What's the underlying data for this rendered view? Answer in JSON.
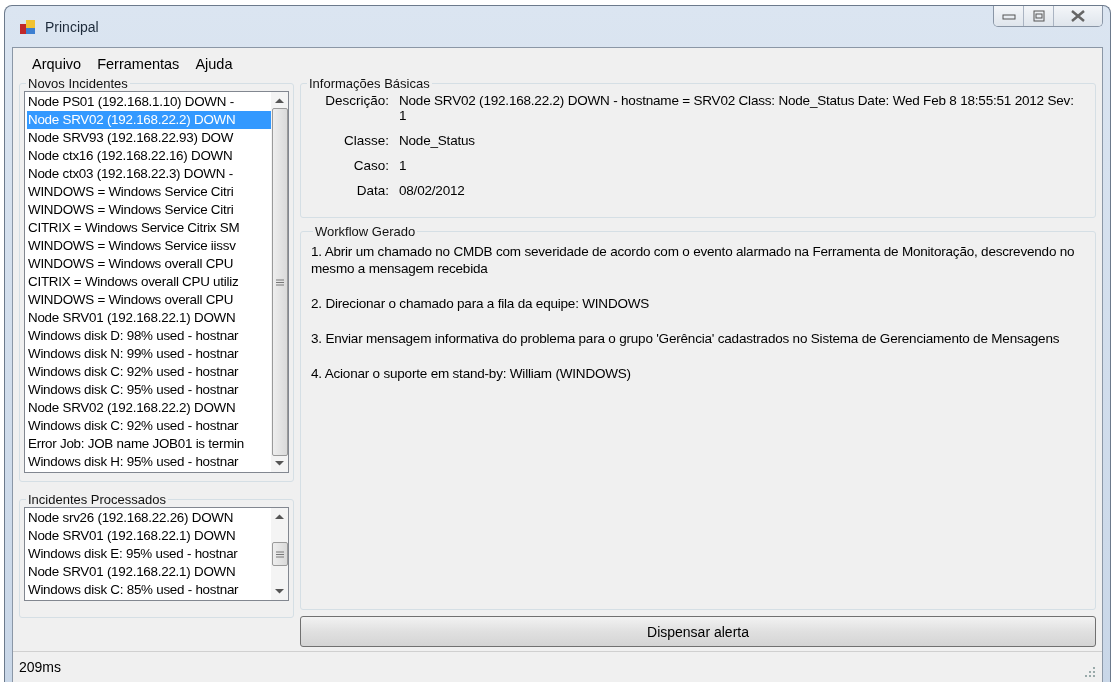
{
  "window": {
    "title": "Principal"
  },
  "menu": [
    "Arquivo",
    "Ferramentas",
    "Ajuda"
  ],
  "new_incidents": {
    "title": "Novos Incidentes",
    "items": [
      {
        "text": "Node PS01 (192.168.1.10) DOWN -",
        "selected": false
      },
      {
        "text": "Node SRV02 (192.168.22.2) DOWN",
        "selected": true
      },
      {
        "text": "Node SRV93 (192.168.22.93) DOW",
        "selected": false
      },
      {
        "text": "Node ctx16 (192.168.22.16) DOWN",
        "selected": false
      },
      {
        "text": "Node ctx03 (192.168.22.3) DOWN -",
        "selected": false
      },
      {
        "text": "WINDOWS = Windows Service Citri",
        "selected": false
      },
      {
        "text": "WINDOWS = Windows Service Citri",
        "selected": false
      },
      {
        "text": "CITRIX = Windows Service Citrix SM",
        "selected": false
      },
      {
        "text": "WINDOWS = Windows Service iissv",
        "selected": false
      },
      {
        "text": "WINDOWS = Windows overall CPU",
        "selected": false
      },
      {
        "text": "CITRIX = Windows overall CPU utiliz",
        "selected": false
      },
      {
        "text": "WINDOWS = Windows overall CPU",
        "selected": false
      },
      {
        "text": "Node SRV01 (192.168.22.1) DOWN",
        "selected": false
      },
      {
        "text": "Windows disk D: 98% used - hostnar",
        "selected": false
      },
      {
        "text": "Windows disk N: 99% used - hostnar",
        "selected": false
      },
      {
        "text": "Windows disk C: 92% used - hostnar",
        "selected": false
      },
      {
        "text": "Windows disk C: 95% used - hostnar",
        "selected": false
      },
      {
        "text": "Node SRV02 (192.168.22.2) DOWN",
        "selected": false
      },
      {
        "text": "Windows disk C: 92% used - hostnar",
        "selected": false
      },
      {
        "text": "Error Job: JOB name JOB01 is termin",
        "selected": false
      },
      {
        "text": "Windows disk H: 95% used - hostnar",
        "selected": false
      }
    ]
  },
  "processed_incidents": {
    "title": "Incidentes Processados",
    "items": [
      {
        "text": "Node srv26 (192.168.22.26) DOWN",
        "selected": false
      },
      {
        "text": "Node SRV01 (192.168.22.1) DOWN",
        "selected": false
      },
      {
        "text": "Windows disk E: 95% used - hostnar",
        "selected": false
      },
      {
        "text": "Node SRV01 (192.168.22.1) DOWN",
        "selected": false
      },
      {
        "text": "Windows disk C: 85% used - hostnar",
        "selected": false
      }
    ]
  },
  "basic_info": {
    "title": "Informações Básicas",
    "fields": [
      {
        "label": "Descrição:",
        "value": "Node SRV02 (192.168.22.2) DOWN - hostname = SRV02 Class: Node_Status Date: Wed Feb 8 18:55:51 2012 Sev: 1"
      },
      {
        "label": "Classe:",
        "value": "Node_Status"
      },
      {
        "label": "Caso:",
        "value": "1"
      },
      {
        "label": "Data:",
        "value": "08/02/2012"
      }
    ]
  },
  "workflow": {
    "title": "Workflow Gerado",
    "steps": [
      "1. Abrir um chamado no CMDB com severidade de acordo com o evento alarmado na Ferramenta de Monitoração, descrevendo no mesmo a mensagem recebida",
      "2. Direcionar o chamado para a fila da equipe: WINDOWS",
      "3. Enviar mensagem informativa do problema para o grupo 'Gerência' cadastrados no Sistema de Gerenciamento de Mensagens",
      "4. Acionar o suporte em stand-by: William (WINDOWS)"
    ]
  },
  "dismiss_button": "Dispensar alerta",
  "status_bar": "209ms"
}
